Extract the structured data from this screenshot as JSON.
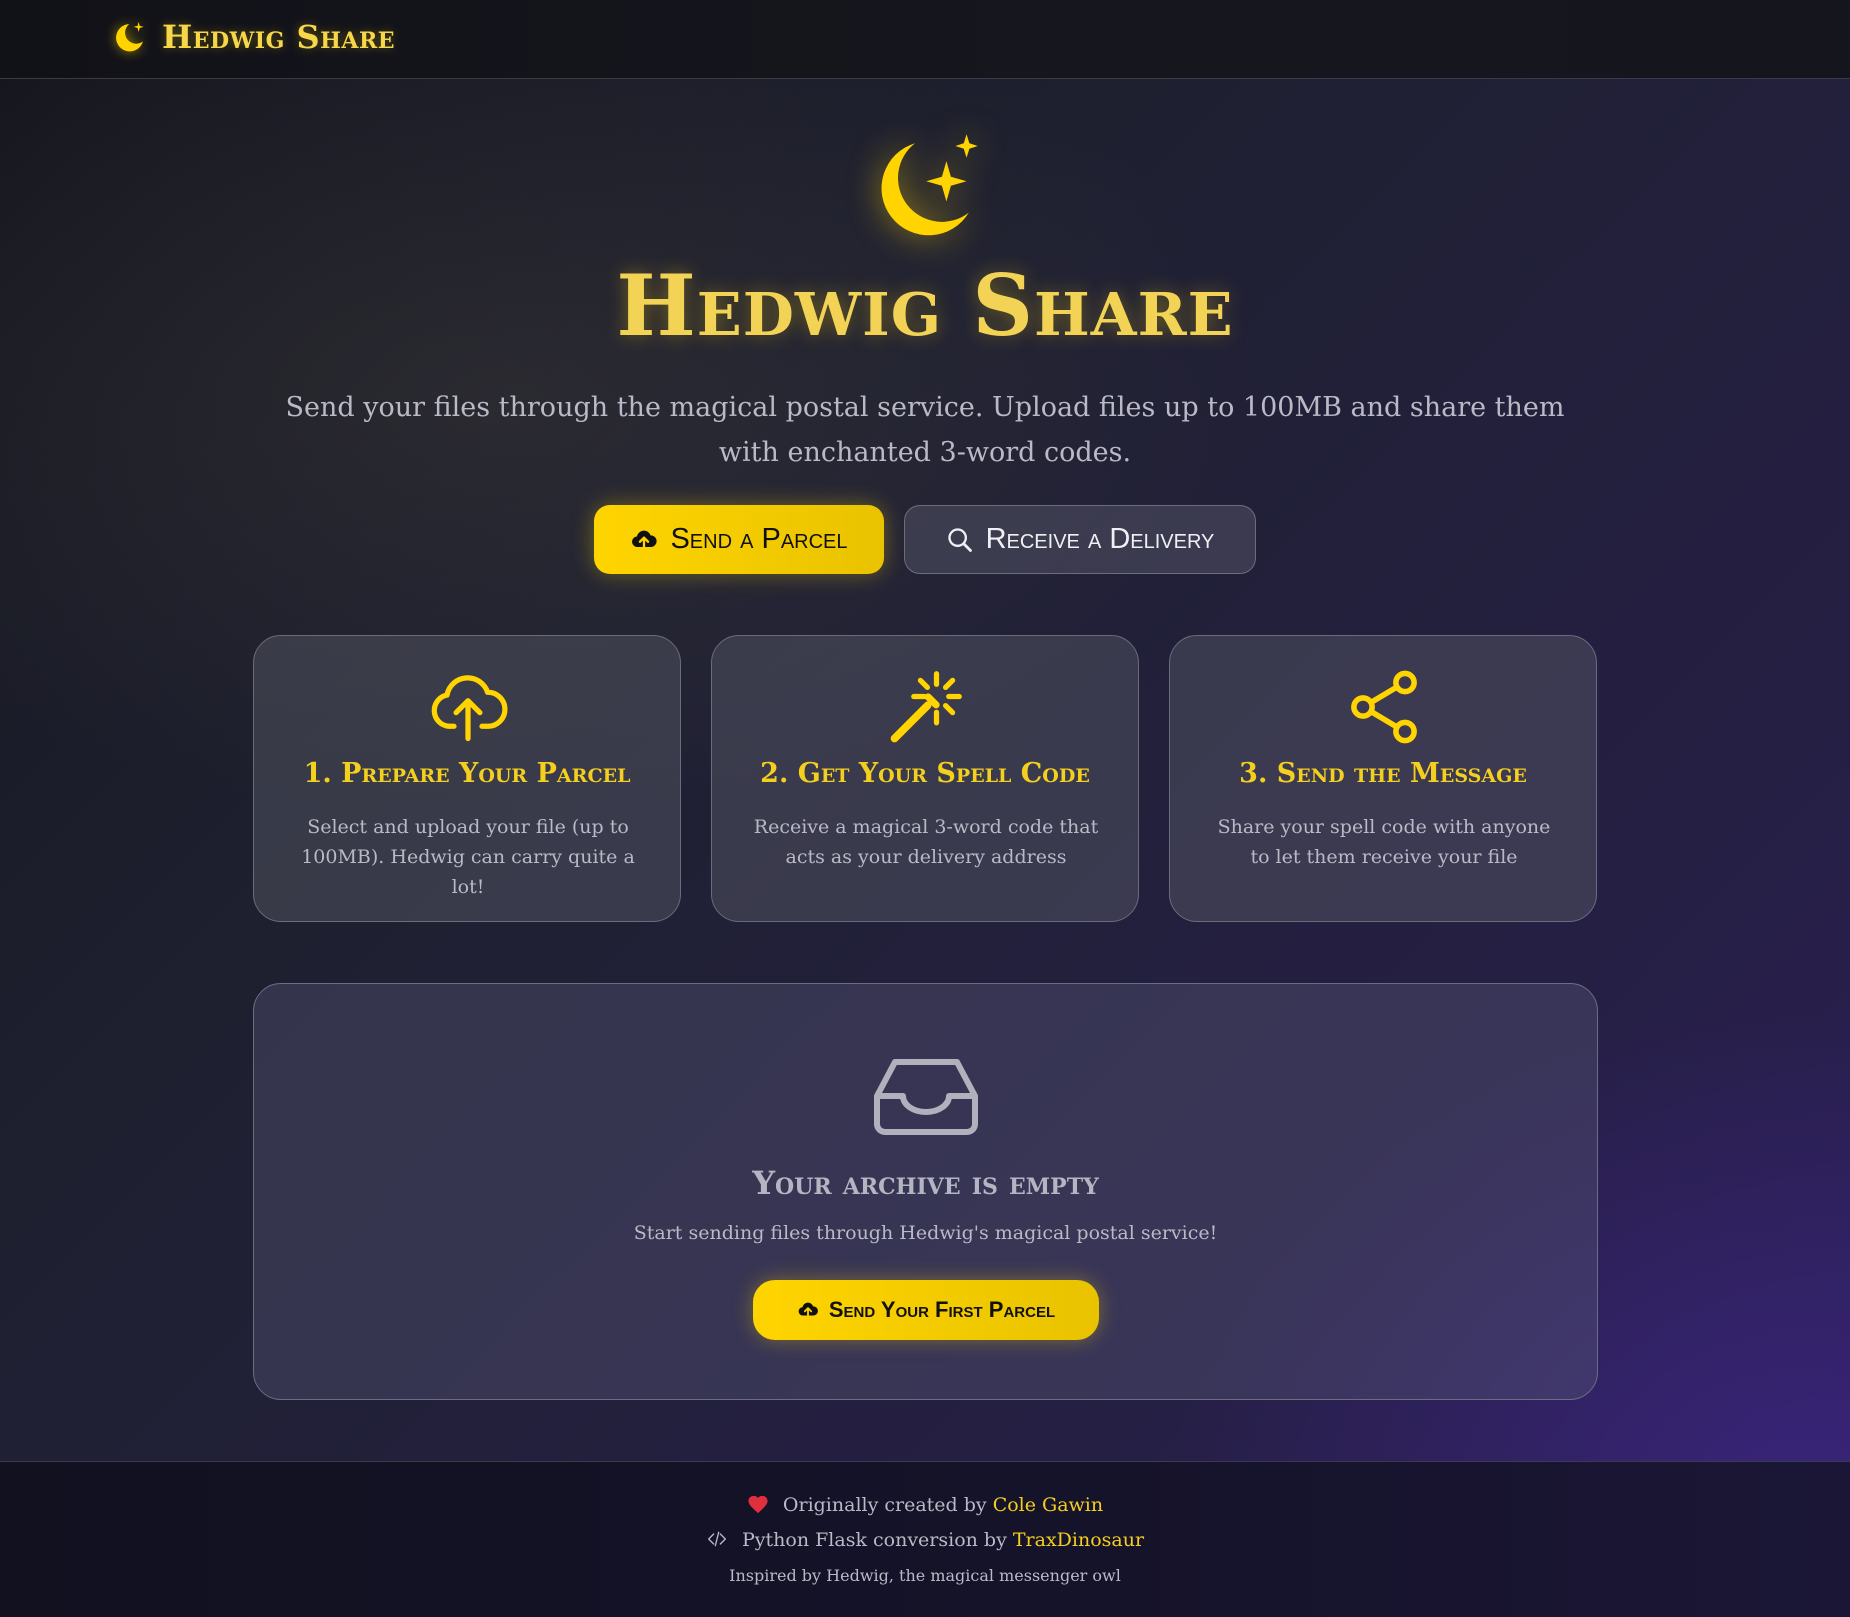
{
  "header": {
    "brand": "Hedwig Share"
  },
  "hero": {
    "title": "Hedwig Share",
    "subtitle": "Send your files through the magical postal service. Upload files up to 100MB and share them with enchanted 3-word codes.",
    "send_label": "Send a Parcel",
    "receive_label": "Receive a Delivery"
  },
  "steps": [
    {
      "title": "1. Prepare Your Parcel",
      "text": "Select and upload your file (up to 100MB). Hedwig can carry quite a lot!"
    },
    {
      "title": "2. Get Your Spell Code",
      "text": "Receive a magical 3-word code that acts as your delivery address"
    },
    {
      "title": "3. Send the Message",
      "text": "Share your spell code with anyone to let them receive your file"
    }
  ],
  "archive": {
    "title": "Your archive is empty",
    "text": "Start sending files through Hedwig's magical postal service!",
    "button_label": "Send Your First Parcel"
  },
  "footer": {
    "line1_prefix": "Originally created by",
    "line1_link": "Cole Gawin",
    "line2_prefix": "Python Flask conversion by",
    "line2_link": "TraxDinosaur",
    "line3": "Inspired by Hedwig, the magical messenger owl"
  },
  "colors": {
    "accent": "#ffd400",
    "heart": "#e0303e"
  },
  "icons": [
    "moon-stars-icon",
    "upload-cloud-icon",
    "search-icon",
    "magic-wand-icon",
    "share-icon",
    "inbox-icon",
    "heart-icon",
    "code-icon"
  ]
}
